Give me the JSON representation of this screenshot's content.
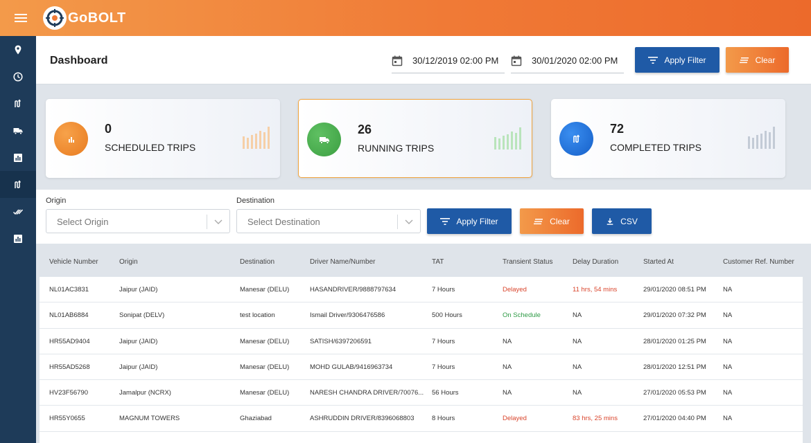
{
  "app": {
    "logo_text": "GoBOLT",
    "brand_color": "#f07a36",
    "sidebar_color": "#1e3b59"
  },
  "sidebar": {
    "items": [
      {
        "icon": "map-pin-icon"
      },
      {
        "icon": "clock-icon"
      },
      {
        "icon": "route-icon"
      },
      {
        "icon": "truck-icon"
      },
      {
        "icon": "bar-chart-icon"
      },
      {
        "icon": "route-icon",
        "active": true
      },
      {
        "icon": "double-check-icon"
      },
      {
        "icon": "bar-chart-icon"
      }
    ]
  },
  "header": {
    "title": "Dashboard",
    "date_from": "30/12/2019 02:00 PM",
    "date_to": "30/01/2020 02:00 PM",
    "apply_label": "Apply Filter",
    "clear_label": "Clear"
  },
  "cards": [
    {
      "count": "0",
      "label": "SCHEDULED TRIPS",
      "icon": "bar-chart-icon",
      "color": "#f08a2c"
    },
    {
      "count": "26",
      "label": "RUNNING TRIPS",
      "icon": "truck-icon",
      "color": "#4cae4f"
    },
    {
      "count": "72",
      "label": "COMPLETED TRIPS",
      "icon": "route-icon",
      "color": "#1c6fd8"
    }
  ],
  "filters": {
    "origin_label": "Origin",
    "origin_placeholder": "Select Origin",
    "destination_label": "Destination",
    "destination_placeholder": "Select Destination",
    "apply_label": "Apply Filter",
    "clear_label": "Clear",
    "csv_label": "CSV"
  },
  "table": {
    "columns": [
      "Vehicle Number",
      "Origin",
      "Destination",
      "Driver Name/Number",
      "TAT",
      "Transient Status",
      "Delay Duration",
      "Started At",
      "Customer Ref. Number"
    ],
    "rows": [
      [
        "NL01AC3831",
        "Jaipur (JAID)",
        "Manesar (DELU)",
        "HASANDRIVER/9888797634",
        "7 Hours",
        "Delayed",
        "11 hrs, 54 mins",
        "29/01/2020 08:51 PM",
        "NA"
      ],
      [
        "NL01AB6884",
        "Sonipat (DELV)",
        "test location",
        "Ismail Driver/9306476586",
        "500 Hours",
        "On Schedule",
        "NA",
        "29/01/2020 07:32 PM",
        "NA"
      ],
      [
        "HR55AD9404",
        "Jaipur (JAID)",
        "Manesar (DELU)",
        "SATISH/6397206591",
        "7 Hours",
        "NA",
        "NA",
        "28/01/2020 01:25 PM",
        "NA"
      ],
      [
        "HR55AD5268",
        "Jaipur (JAID)",
        "Manesar (DELU)",
        "MOHD GULAB/9416963734",
        "7 Hours",
        "NA",
        "NA",
        "28/01/2020 12:51 PM",
        "NA"
      ],
      [
        "HV23F56790",
        "Jamalpur (NCRX)",
        "Manesar (DELU)",
        "NARESH CHANDRA DRIVER/70076...",
        "56 Hours",
        "NA",
        "NA",
        "27/01/2020 05:53 PM",
        "NA"
      ],
      [
        "HR55Y0655",
        "MAGNUM TOWERS",
        "Ghaziabad",
        "ASHRUDDIN DRIVER/8396068803",
        "8 Hours",
        "Delayed",
        "83 hrs, 25 mins",
        "27/01/2020 04:40 PM",
        "NA"
      ]
    ]
  }
}
